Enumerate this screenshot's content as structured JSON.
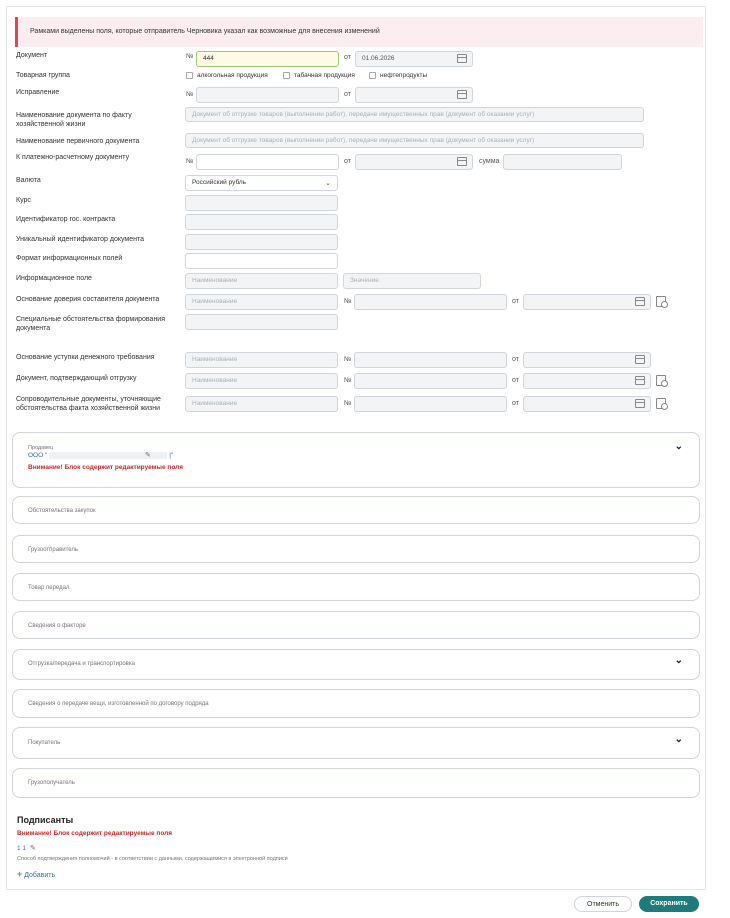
{
  "notice": "Рамками выделены поля, которые отправитель Черновика указал как возможные для внесения изменений",
  "form": {
    "document_label": "Документ",
    "no_sign": "№",
    "from_sign": "от",
    "sum_sign": "сумма",
    "document_number": "444",
    "document_date": "01.06.2026",
    "product_group_label": "Товарная группа",
    "product_groups": [
      "алкогольная продукция",
      "табачная продукция",
      "нефтепродукты"
    ],
    "correction_label": "Исправление",
    "doc_name_fact_label": "Наименование документа по факту хозяйственной жизни",
    "doc_name_fact_placeholder": "Документ об отгрузке товаров (выполнении работ), передаче имущественных прав (документ об оказании услуг)",
    "primary_doc_label": "Наименование первичного документа",
    "primary_doc_placeholder": "Документ об отгрузке товаров (выполнении работ), передаче имущественных прав (документ об оказании услуг)",
    "payment_doc_label": "К платежно-расчетному документу",
    "currency_label": "Валюта",
    "currency_value": "Российский рубль",
    "rate_label": "Курс",
    "gov_contract_label": "Идентификатор гос. контракта",
    "unique_id_label": "Уникальный идентификатор документа",
    "info_format_label": "Формат информационных полей",
    "info_field_label": "Информационное поле",
    "name_placeholder": "Наименование",
    "value_placeholder": "Значение",
    "trust_basis_label": "Основание доверия составителя документа",
    "special_circ_label": "Специальные обстоятельства формирования документа",
    "assignment_label": "Основание уступки денежного требования",
    "shipment_doc_label": "Документ, подтверждающий отгрузку",
    "accompanying_label": "Сопроводительные документы, уточняющие обстоятельства факта хозяйственной жизни"
  },
  "seller": {
    "title": "Продавец",
    "name_prefix": "ООО \"",
    "name_suffix": "|\"",
    "warning": "Внимание! Блок содержит редактируемые поля"
  },
  "sections": [
    "Обстоятельства закупок",
    "Грузоотправитель",
    "Товар передал",
    "Сведения о факторе",
    "Отгрузка/передача и транспортировка",
    "Сведения о передаче вещи, изготовленной по договору подряда",
    "Покупатель",
    "Грузополучатель"
  ],
  "signers": {
    "title": "Подписанты",
    "warning": "Внимание! Блок содержит редактируемые поля",
    "signer": "1 1",
    "hint": "Способ подтверждения полномочий - в соответствии с данными, содержащимися в электронной подписи",
    "add": "Добавить"
  },
  "footer": {
    "cancel": "Отменить",
    "save": "Сохранить"
  }
}
